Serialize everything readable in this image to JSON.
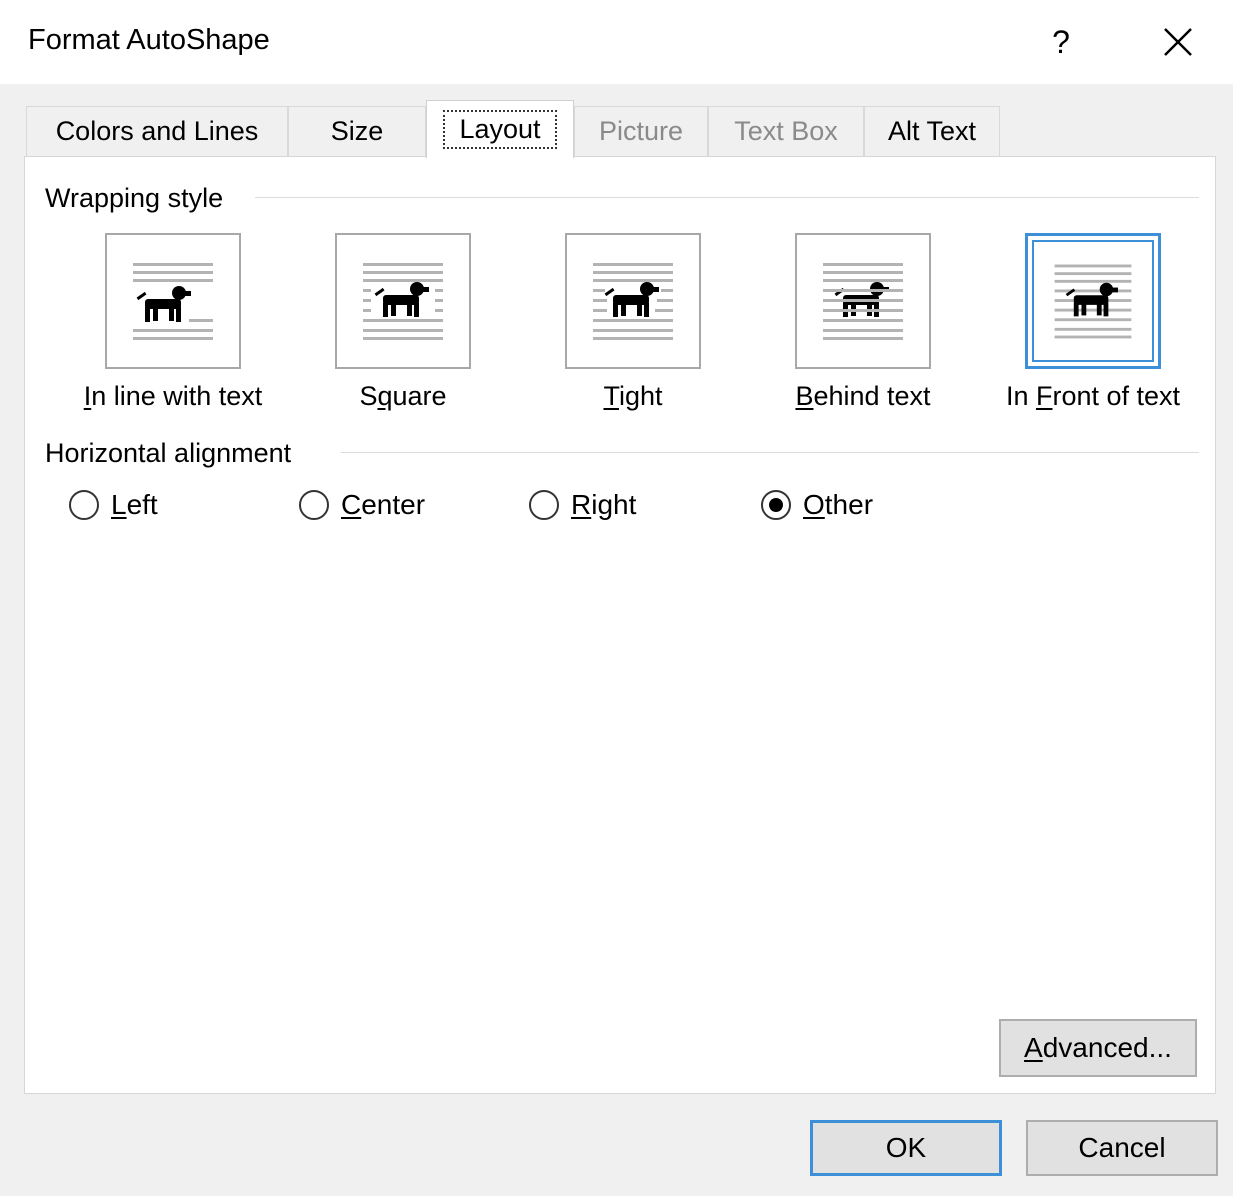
{
  "window": {
    "title": "Format AutoShape",
    "help_label": "?"
  },
  "tabs": [
    {
      "label": "Colors and Lines",
      "state": "normal"
    },
    {
      "label": "Size",
      "state": "normal"
    },
    {
      "label": "Layout",
      "state": "active"
    },
    {
      "label": "Picture",
      "state": "disabled"
    },
    {
      "label": "Text Box",
      "state": "disabled"
    },
    {
      "label": "Alt Text",
      "state": "normal"
    }
  ],
  "wrapping": {
    "heading": "Wrapping style",
    "options": [
      {
        "label_pre": "",
        "label_key": "I",
        "label_post": "n line with text"
      },
      {
        "label_pre": "S",
        "label_key": "q",
        "label_post": "uare"
      },
      {
        "label_pre": "",
        "label_key": "T",
        "label_post": "ight"
      },
      {
        "label_pre": "",
        "label_key": "B",
        "label_post": "ehind text"
      },
      {
        "label_pre": "In ",
        "label_key": "F",
        "label_post": "ront of text"
      }
    ],
    "selected": "In Front of text"
  },
  "alignment": {
    "heading": "Horizontal alignment",
    "options": [
      {
        "label_key": "L",
        "label_post": "eft"
      },
      {
        "label_key": "C",
        "label_post": "enter"
      },
      {
        "label_key": "R",
        "label_post": "ight"
      },
      {
        "label_key": "O",
        "label_post": "ther"
      }
    ],
    "selected": "Other"
  },
  "buttons": {
    "advanced_key": "A",
    "advanced_post": "dvanced...",
    "ok": "OK",
    "cancel": "Cancel"
  },
  "colors": {
    "accent": "#3d8fd8",
    "panel_bg": "#ffffff",
    "dialog_bg": "#f0f0f0"
  }
}
